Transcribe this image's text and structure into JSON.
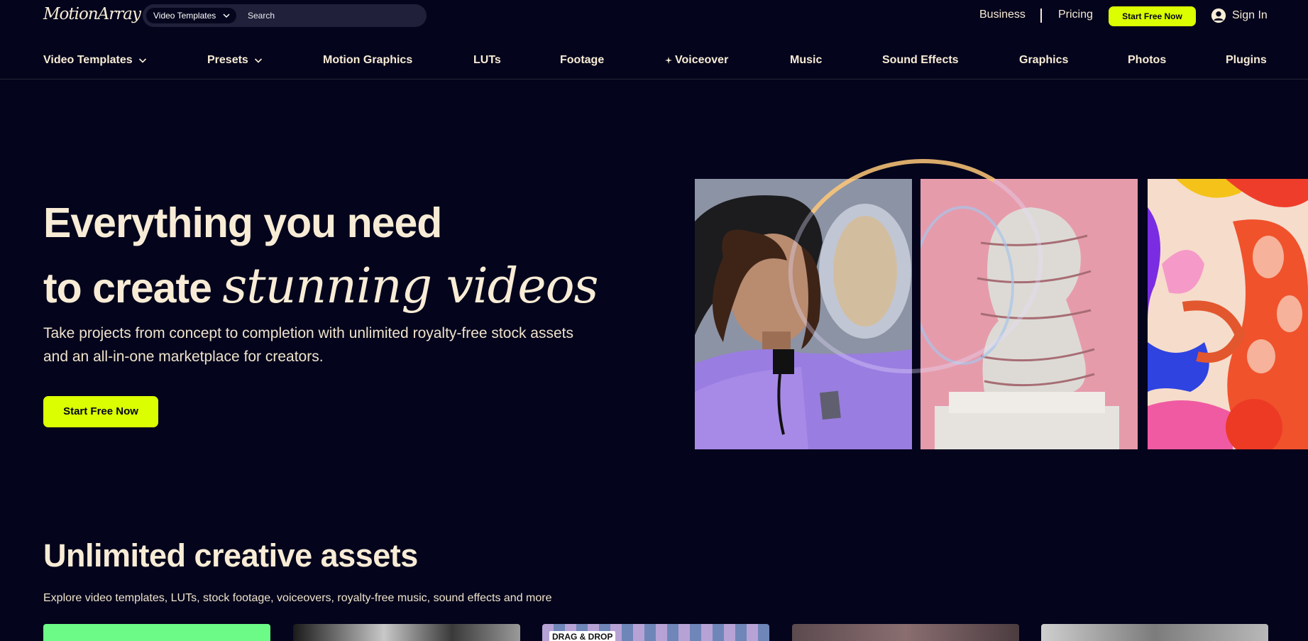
{
  "brand": {
    "logo_text": "MotionArray",
    "accent": "#dbff00",
    "background": "#04041c",
    "text": "#f8ecd6"
  },
  "search": {
    "category": "Video Templates",
    "placeholder": "Search"
  },
  "top_links": {
    "business": "Business",
    "pricing": "Pricing",
    "start_button": "Start Free Now",
    "sign_in": "Sign In"
  },
  "nav": {
    "items": [
      {
        "label": "Video Templates",
        "dropdown": true
      },
      {
        "label": "Presets",
        "dropdown": true
      },
      {
        "label": "Motion Graphics"
      },
      {
        "label": "LUTs"
      },
      {
        "label": "Footage"
      },
      {
        "label": "Voiceover",
        "icon": "sparkle-icon"
      },
      {
        "label": "Music"
      },
      {
        "label": "Sound Effects"
      },
      {
        "label": "Graphics"
      },
      {
        "label": "Photos"
      },
      {
        "label": "Plugins"
      }
    ]
  },
  "hero": {
    "title_line1": "Everything you need",
    "title_line2_plain": "to create ",
    "title_line2_script": "stunning videos",
    "subtitle": "Take projects from concept to completion with unlimited royalty-free stock assets and an all-in-one marketplace for creators.",
    "cta": "Start Free Now"
  },
  "assets": {
    "title": "Unlimited creative assets",
    "subtitle": "Explore video templates, LUTs, stock footage, voiceovers, royalty-free music, sound effects and more",
    "cards": [
      {
        "label": ""
      },
      {
        "label": ""
      },
      {
        "label": "DRAG & DROP"
      },
      {
        "label": ""
      },
      {
        "label": ""
      }
    ]
  }
}
